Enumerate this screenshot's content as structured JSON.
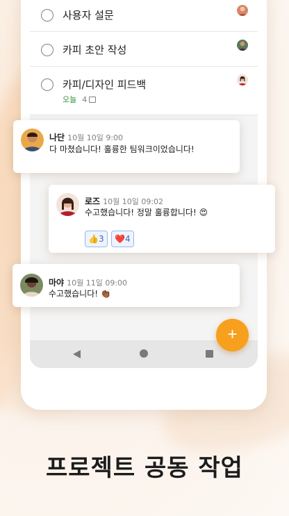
{
  "tasks": [
    {
      "title": "사용자 설문"
    },
    {
      "title": "카피 초안 작성"
    },
    {
      "title": "카피/디자인 피드백",
      "due": "오늘",
      "comments": "4"
    }
  ],
  "comments": [
    {
      "author": "나단",
      "date": "10월 10일 9:00",
      "text": "다 마쳤습니다! 훌륭한 팀워크이었습니다!"
    },
    {
      "author": "로즈",
      "date": "10월 10일 09:02",
      "text": "수고했습니다! 정말 훌륭합니다! 😍",
      "reactions": [
        {
          "emoji": "👍",
          "count": "3"
        },
        {
          "emoji": "❤️",
          "count": "4"
        }
      ]
    },
    {
      "author": "마야",
      "date": "10월 11일 09:00",
      "text": "수고했습니다! 👏🏾"
    }
  ],
  "fab": {
    "label": "+"
  },
  "headline": "프로젝트 공동 작업",
  "colors": {
    "accent": "#f7a01e",
    "due_green": "#2f8f3a"
  }
}
